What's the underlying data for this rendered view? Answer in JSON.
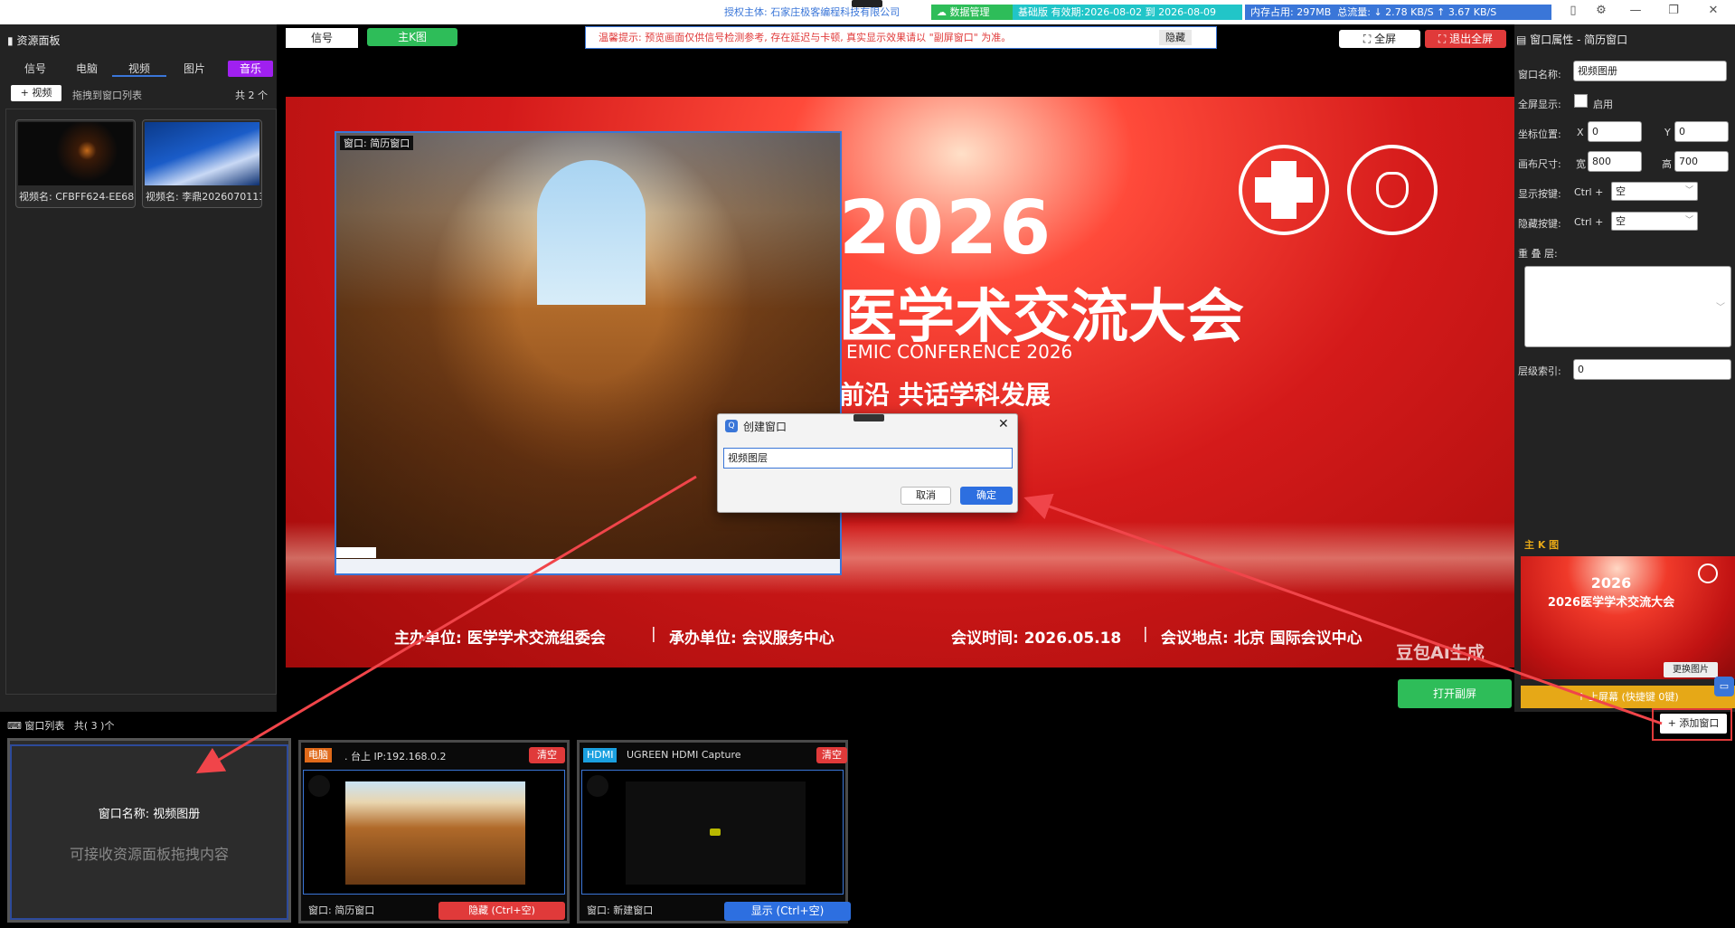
{
  "topbar": {
    "license": "授权主体: 石家庄极客编程科技有限公司",
    "data_mgmt": "数据管理",
    "edition": "基础版 有效期:2026-08-02 到 2026-08-09",
    "memory": "内存占用:  297MB",
    "traffic": "总流量: ↓ 2.78 KB/S    ↑ 3.67 KB/S"
  },
  "resource_panel": {
    "title": "资源面板",
    "tabs": [
      "信号",
      "电脑",
      "视频",
      "图片",
      "音乐"
    ],
    "active_tab": "视频",
    "add_button": "视频",
    "drag_hint": "拖拽到窗口列表",
    "count": "共 2 个",
    "items": [
      {
        "caption": "视频名: CFBFF624-EE68"
      },
      {
        "caption": "视频名: 李鼎2026070113"
      }
    ]
  },
  "center": {
    "tab_signal": "信号",
    "tab_main": "主K图",
    "notice": "温馨提示: 预览画面仅供信号检测参考, 存在延迟与卡顿, 真实显示效果请以 \"副屏窗口\" 为准。",
    "hide_notice": "隐藏",
    "fullscreen": "全屏",
    "exit_fullscreen": "退出全屏",
    "open_secondary": "打开副屏",
    "preview_window_label": "窗口: 简历窗口",
    "banner": {
      "year": "2026",
      "title": "医学术交流大会",
      "subtitle_en": "EMIC CONFERENCE 2026",
      "slogan": "前沿  共话学科发展",
      "organizer": "主办单位: 医学学术交流组委会",
      "undertaker": "承办单位: 会议服务中心",
      "time": "会议时间: 2026.05.18",
      "location": "会议地点: 北京 国际会议中心",
      "watermark": "豆包AI生成"
    }
  },
  "dialog": {
    "title": "创建窗口",
    "input_value": "视频图层",
    "cancel": "取消",
    "ok": "确定"
  },
  "properties": {
    "title": "窗口属性 - 简历窗口",
    "name_label": "窗口名称:",
    "name_value": "视频图册",
    "fullscreen_label": "全屏显示:",
    "fullscreen_check": "启用",
    "coord_label": "坐标位置:",
    "x_label": "X",
    "x_value": "0",
    "y_label": "Y",
    "y_value": "0",
    "size_label": "画布尺寸:",
    "w_label": "宽",
    "w_value": "800",
    "h_label": "高",
    "h_value": "700",
    "show_key_label": "显示按键:",
    "hide_key_label": "隐藏按键:",
    "ctrl_plus": "Ctrl +",
    "key_empty": "空",
    "overlay_label": "重 叠 层:",
    "layer_index_label": "层级索引:",
    "layer_index_value": "0",
    "main_k_label": "主 K 图",
    "change_image": "更换图片",
    "to_screen": "上屏幕 (快捷键 0键)",
    "add_window": "添加窗口",
    "mini_year": "2026",
    "mini_title": "2026医学学术交流大会"
  },
  "window_list": {
    "title": "窗口列表",
    "count": "共( 3 )个",
    "drop_card": {
      "name": "窗口名称: 视频图册",
      "hint": "可接收资源面板拖拽内容"
    },
    "cards": [
      {
        "type": "电脑",
        "source": ". 台上 IP:192.168.0.2",
        "clear": "清空",
        "window": "窗口: 简历窗口",
        "action": "隐藏 (Ctrl+空)"
      },
      {
        "type": "HDMI",
        "source": "UGREEN HDMI Capture",
        "clear": "清空",
        "window": "窗口: 新建窗口",
        "action": "显示 (Ctrl+空)"
      }
    ]
  },
  "colors": {
    "accent_purple": "#a020f0",
    "green": "#2ebd59",
    "cyan": "#21c5c8",
    "red": "#e03a3a",
    "blue": "#2d6fe0",
    "gold": "#e6a817"
  }
}
